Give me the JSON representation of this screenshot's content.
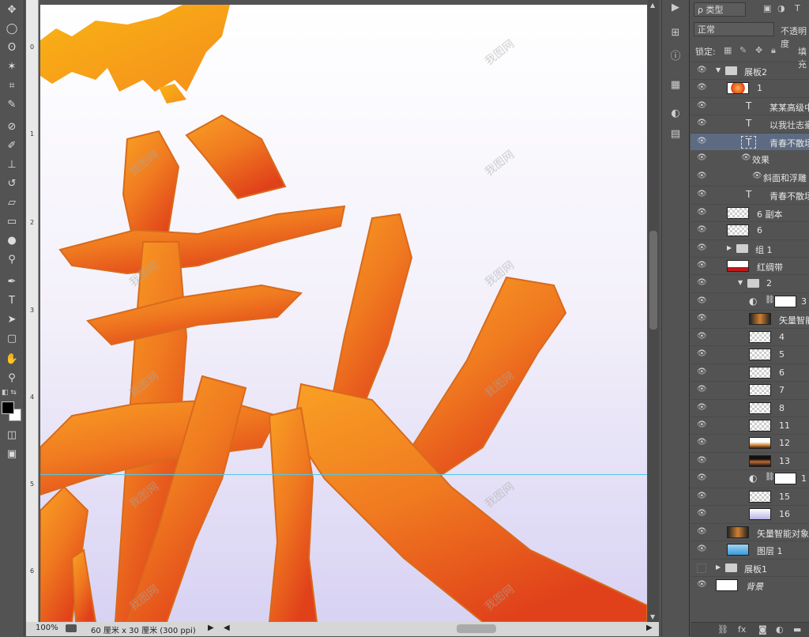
{
  "colors": {
    "artwork_orange": "#f07a20",
    "artwork_deep": "#e0401a",
    "artwork_gold": "#f8aa10",
    "guide": "#50c8e8",
    "selected_layer": "#5c6b82"
  },
  "toolbar": {
    "tools": [
      "move-icon",
      "marquee-icon",
      "lasso-icon",
      "magic-wand-icon",
      "crop-icon",
      "eyedropper-icon",
      "healing-brush-icon",
      "brush-icon",
      "clone-stamp-icon",
      "history-brush-icon",
      "eraser-icon",
      "gradient-icon",
      "blur-icon",
      "dodge-icon",
      "pen-icon",
      "type-icon",
      "path-selection-icon",
      "shape-icon",
      "hand-icon",
      "zoom-icon"
    ],
    "type_glyph": "T"
  },
  "ruler": {
    "marks": [
      "0",
      "1",
      "2",
      "3",
      "4",
      "5",
      "6"
    ]
  },
  "canvas": {
    "watermark": "我图网"
  },
  "status": {
    "zoom": "100%",
    "doc_size": "60 厘米 x 30 厘米 (300 ppi)"
  },
  "layers_panel": {
    "filter_label": "ρ 类型",
    "blend_mode": "正常",
    "opacity_label": "不透明度",
    "lock_label": "锁定:",
    "fill_label": "填充",
    "layers": [
      {
        "name": "展板2",
        "kind": "group-open",
        "indent": 0
      },
      {
        "name": "1",
        "kind": "image",
        "indent": 1,
        "thumb": "orange"
      },
      {
        "name": "某某高级中学",
        "kind": "text",
        "indent": 1
      },
      {
        "name": "以我壮志豪情",
        "kind": "text",
        "indent": 1
      },
      {
        "name": "青春不散场",
        "kind": "text",
        "indent": 1,
        "selected": true
      },
      {
        "name": "效果",
        "kind": "effect",
        "indent": 2
      },
      {
        "name": "斜面和浮雕",
        "kind": "effect-item",
        "indent": 3
      },
      {
        "name": "青春不散场",
        "kind": "text",
        "indent": 1
      },
      {
        "name": "6 副本",
        "kind": "image",
        "indent": 1,
        "thumb": "trans"
      },
      {
        "name": "6",
        "kind": "image",
        "indent": 1,
        "thumb": "trans"
      },
      {
        "name": "组 1",
        "kind": "group-closed",
        "indent": 1
      },
      {
        "name": "红绸带",
        "kind": "image",
        "indent": 1,
        "thumb": "ribbon"
      },
      {
        "name": "2",
        "kind": "group-open",
        "indent": 2
      },
      {
        "name": "3",
        "kind": "adjust",
        "indent": 3
      },
      {
        "name": "矢量智能对象",
        "kind": "image",
        "indent": 3,
        "thumb": "dark"
      },
      {
        "name": "4",
        "kind": "image",
        "indent": 3,
        "thumb": "trans"
      },
      {
        "name": "5",
        "kind": "image",
        "indent": 3,
        "thumb": "trans"
      },
      {
        "name": "6",
        "kind": "image",
        "indent": 3,
        "thumb": "trans"
      },
      {
        "name": "7",
        "kind": "image",
        "indent": 3,
        "thumb": "trans"
      },
      {
        "name": "8",
        "kind": "image",
        "indent": 3,
        "thumb": "trans"
      },
      {
        "name": "11",
        "kind": "image",
        "indent": 3,
        "thumb": "trans"
      },
      {
        "name": "12",
        "kind": "image",
        "indent": 3,
        "thumb": "sunset"
      },
      {
        "name": "13",
        "kind": "image",
        "indent": 3,
        "thumb": "darkband"
      },
      {
        "name": "1",
        "kind": "adjust",
        "indent": 3
      },
      {
        "name": "15",
        "kind": "image",
        "indent": 3,
        "thumb": "trans"
      },
      {
        "name": "16",
        "kind": "image",
        "indent": 3,
        "thumb": "lavender"
      },
      {
        "name": "矢量智能对象",
        "kind": "image",
        "indent": 1,
        "thumb": "dark"
      },
      {
        "name": "图层 1",
        "kind": "image",
        "indent": 1,
        "thumb": "sky"
      },
      {
        "name": "展板1",
        "kind": "group-closed",
        "indent": 0,
        "hidden": true
      },
      {
        "name": "背景",
        "kind": "image",
        "indent": 0,
        "thumb": "white",
        "italic": true
      }
    ]
  }
}
